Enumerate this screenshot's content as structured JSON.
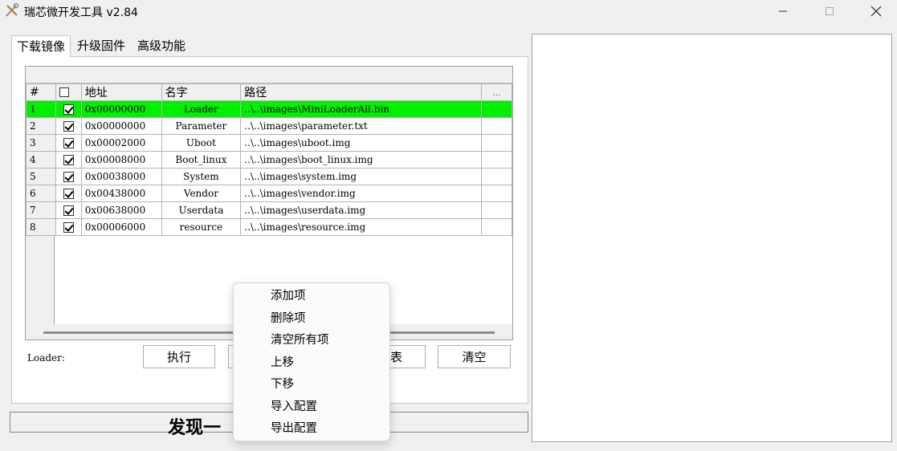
{
  "window": {
    "title": "瑞芯微开发工具 v2.84",
    "icon": "tools-icon"
  },
  "tabs": [
    {
      "label": "下载镜像",
      "active": true
    },
    {
      "label": "升级固件",
      "active": false
    },
    {
      "label": "高级功能",
      "active": false
    }
  ],
  "grid": {
    "headers": {
      "num": "#",
      "addr": "地址",
      "name": "名字",
      "path": "路径",
      "more": "..."
    },
    "rows": [
      {
        "num": "1",
        "checked": true,
        "addr": "0x00000000",
        "name": "Loader",
        "path": "..\\..\\images\\MiniLoaderAll.bin",
        "selected": true
      },
      {
        "num": "2",
        "checked": true,
        "addr": "0x00000000",
        "name": "Parameter",
        "path": "..\\..\\images\\parameter.txt",
        "selected": false
      },
      {
        "num": "3",
        "checked": true,
        "addr": "0x00002000",
        "name": "Uboot",
        "path": "..\\..\\images\\uboot.img",
        "selected": false
      },
      {
        "num": "4",
        "checked": true,
        "addr": "0x00008000",
        "name": "Boot_linux",
        "path": "..\\..\\images\\boot_linux.img",
        "selected": false
      },
      {
        "num": "5",
        "checked": true,
        "addr": "0x00038000",
        "name": "System",
        "path": "..\\..\\images\\system.img",
        "selected": false
      },
      {
        "num": "6",
        "checked": true,
        "addr": "0x00438000",
        "name": "Vendor",
        "path": "..\\..\\images\\vendor.img",
        "selected": false
      },
      {
        "num": "7",
        "checked": true,
        "addr": "0x00638000",
        "name": "Userdata",
        "path": "..\\..\\images\\userdata.img",
        "selected": false
      },
      {
        "num": "8",
        "checked": true,
        "addr": "0x00006000",
        "name": "resource",
        "path": "..\\..\\images\\resource.img",
        "selected": false
      }
    ],
    "selected_color": "#00f000"
  },
  "bottom": {
    "loader_label": "Loader:",
    "exec_button": "执行",
    "devlist_button_visible": "表",
    "clear_button": "清空"
  },
  "status": {
    "text": "发现一"
  },
  "context_menu": {
    "items": [
      "添加项",
      "删除项",
      "清空所有项",
      "上移",
      "下移",
      "导入配置",
      "导出配置"
    ]
  }
}
